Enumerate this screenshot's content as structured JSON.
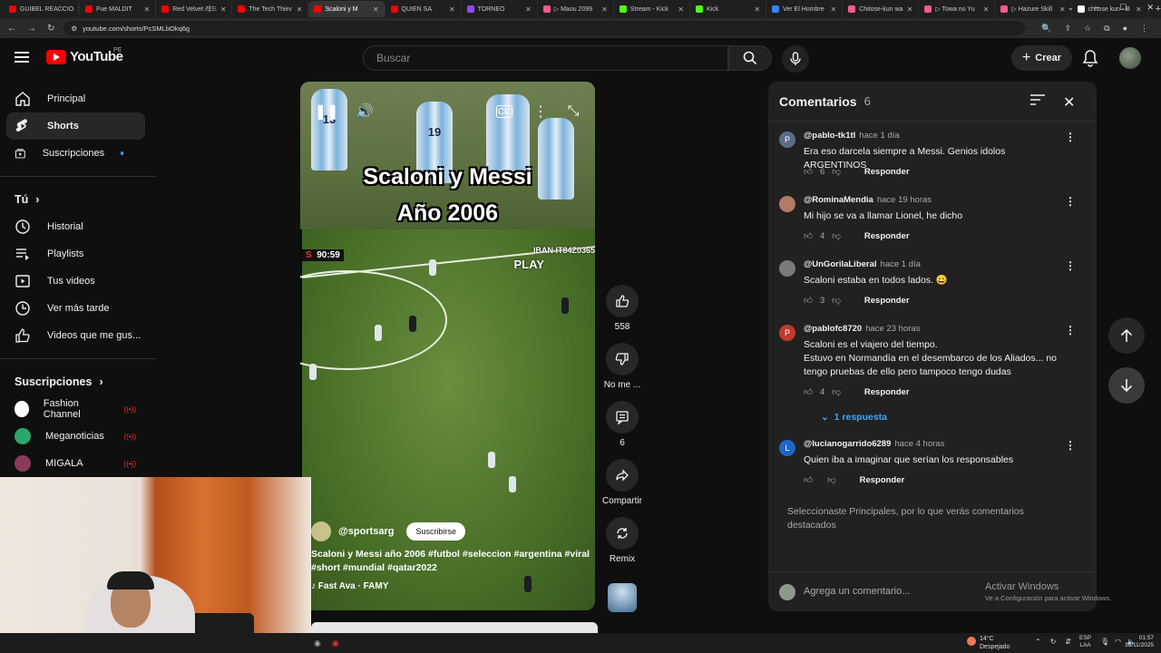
{
  "browser": {
    "tabs": [
      {
        "label": "GUIBEL REACCIO",
        "color": "#ff0000"
      },
      {
        "label": "Fue MALDIT",
        "color": "#ff0000"
      },
      {
        "label": "Red Velvet 레드",
        "color": "#ff0000"
      },
      {
        "label": "The Tech Thiev",
        "color": "#ff0000"
      },
      {
        "label": "Scaloni y M",
        "color": "#ff0000",
        "active": true
      },
      {
        "label": "QUIEN SA",
        "color": "#ff0000"
      },
      {
        "label": "TORNEO",
        "color": "#9146ff"
      },
      {
        "label": "▷ Maou 2099",
        "color": "#ff5a8a"
      },
      {
        "label": "Stream - Kick",
        "color": "#53fc18"
      },
      {
        "label": "Kick",
        "color": "#53fc18"
      },
      {
        "label": "Ver El Hombre",
        "color": "#3b82f6"
      },
      {
        "label": "Chitose-kun wa",
        "color": "#ff5a8a"
      },
      {
        "label": "▷ Towa no Yu",
        "color": "#ff5a8a"
      },
      {
        "label": "▷ Hazure Skill",
        "color": "#ff5a8a"
      },
      {
        "label": "chitose kun - B",
        "color": "#ffffff"
      }
    ],
    "new_tab": "+",
    "url": "youtube.com/shorts/PcSMLbOkq6g"
  },
  "header": {
    "logo_text": "YouTube",
    "logo_region": "PE",
    "search_placeholder": "Buscar",
    "create_label": "Crear"
  },
  "sidebar": {
    "main": [
      {
        "label": "Principal",
        "icon": "home-icon"
      },
      {
        "label": "Shorts",
        "icon": "shorts-icon",
        "active": true
      },
      {
        "label": "Suscripciones",
        "icon": "subscriptions-icon",
        "dot": true
      }
    ],
    "you_heading": "Tú",
    "you": [
      {
        "label": "Historial",
        "icon": "history-icon"
      },
      {
        "label": "Playlists",
        "icon": "playlists-icon"
      },
      {
        "label": "Tus videos",
        "icon": "your-videos-icon"
      },
      {
        "label": "Ver más tarde",
        "icon": "watch-later-icon"
      },
      {
        "label": "Videos que me gus...",
        "icon": "liked-videos-icon"
      }
    ],
    "subs_heading": "Suscripciones",
    "subs": [
      {
        "label": "Fashion Channel",
        "color": "#ffffff",
        "live": true
      },
      {
        "label": "Meganoticias",
        "color": "#2aa76a",
        "live": true
      },
      {
        "label": "MIGALA",
        "color": "#8a3a5a",
        "live": true
      }
    ]
  },
  "video": {
    "overlay_title_1": "Scaloni y Messi",
    "overlay_title_2": "Año 2006",
    "scoreboard_prefix": "S",
    "scoreboard_time": "90:59",
    "iban_text": "IBAN IT84Z0365",
    "play_text": "PLAY",
    "shirt_numbers": [
      "13",
      "19"
    ],
    "channel": "@sportsarg",
    "subscribe_label": "Suscribirse",
    "description": "Scaloni y Messi año 2006 #futbol #seleccion #argentina #viral #short #mundial #qatar2022",
    "music": "♪ Fast Ava · FAMY"
  },
  "actions": {
    "likes": "558",
    "dislike_label": "No me ...",
    "comments_count": "6",
    "share_label": "Compartir",
    "remix_label": "Remix"
  },
  "comments": {
    "title": "Comentarios",
    "count": "6",
    "items": [
      {
        "initial": "P",
        "color": "#5c6b8a",
        "user": "@pablo-tk1tl",
        "time": "hace 1 día",
        "text": "Era eso darcela siempre a Messi. Genios idolos ARGENTINOS",
        "likes": "6",
        "reply": "Responder"
      },
      {
        "initial": "",
        "color": "#b37a66",
        "user": "@RominaMendia",
        "time": "hace 19 horas",
        "text": "Mi hijo se va a llamar Lionel, he dicho",
        "likes": "4",
        "reply": "Responder"
      },
      {
        "initial": "",
        "color": "#7a7a7a",
        "user": "@UnGorilaLiberal",
        "time": "hace 1 día",
        "text": "Scaloni estaba en todos lados. 😄",
        "likes": "3",
        "reply": "Responder"
      },
      {
        "initial": "P",
        "color": "#c0392b",
        "user": "@pablofc8720",
        "time": "hace 23 horas",
        "text": "Scaloni es el viajero del tiempo.\nEstuvo en Normandía en el desembarco de los Aliados... no tengo pruebas de ello pero tampoco tengo dudas",
        "likes": "4",
        "reply": "Responder"
      },
      {
        "initial": "L",
        "color": "#1e66c9",
        "user": "@lucianogarrido6289",
        "time": "hace 4 horas",
        "text": "Quien iba a imaginar que serían los responsables",
        "likes": "",
        "reply": "Responder"
      }
    ],
    "replies_label": "1 respuesta",
    "notice": "Seleccionaste Principales, por lo que verás comentarios destacados",
    "input_placeholder": "Agrega un comentario..."
  },
  "windows": {
    "activate_1": "Activar Windows",
    "activate_2": "Ve a Configuración para activar Windows.",
    "temp": "14°C",
    "weather": "Despejado",
    "lang_1": "ESP",
    "lang_2": "LAA",
    "time": "01:57",
    "date": "15/11/2025"
  }
}
